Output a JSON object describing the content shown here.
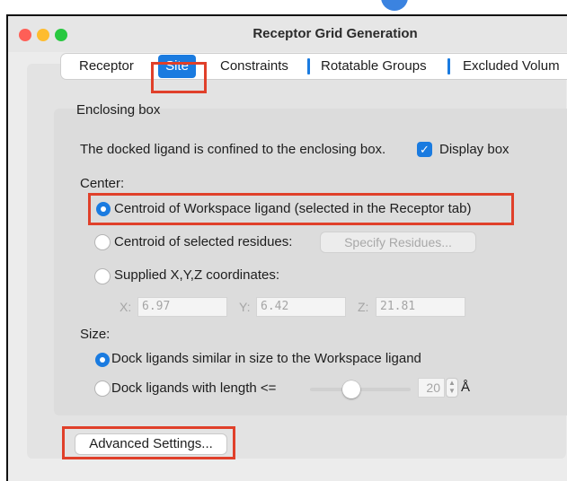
{
  "window": {
    "title": "Receptor Grid Generation"
  },
  "tabs": [
    {
      "label": "Receptor",
      "active": false
    },
    {
      "label": "Site",
      "active": true
    },
    {
      "label": "Constraints",
      "active": false
    },
    {
      "label": "Rotatable Groups",
      "active": false
    },
    {
      "label": "Excluded Volum",
      "active": false
    }
  ],
  "enclosing_box": {
    "group_label": "Enclosing box",
    "description": "The docked ligand is confined to the enclosing box.",
    "display_box": {
      "label": "Display box",
      "checked": true
    }
  },
  "center": {
    "label": "Center:",
    "options": [
      {
        "label": "Centroid of Workspace ligand (selected in the Receptor tab)",
        "selected": true
      },
      {
        "label": "Centroid of selected residues:",
        "selected": false
      },
      {
        "label": "Supplied X,Y,Z coordinates:",
        "selected": false
      }
    ],
    "specify_residues_button": "Specify Residues...",
    "coordinates": {
      "x_label": "X:",
      "x_value": "6.97",
      "y_label": "Y:",
      "y_value": "6.42",
      "z_label": "Z:",
      "z_value": "21.81"
    }
  },
  "size": {
    "label": "Size:",
    "options": [
      {
        "label": "Dock ligands similar in size to the Workspace ligand",
        "selected": true
      },
      {
        "label": "Dock ligands with length <=",
        "selected": false
      }
    ],
    "length_value": "20",
    "length_unit": "Å",
    "slider_level": 0.5
  },
  "advanced_button": "Advanced Settings...",
  "colors": {
    "accent": "#1a7be0",
    "highlight": "#e0402a"
  }
}
